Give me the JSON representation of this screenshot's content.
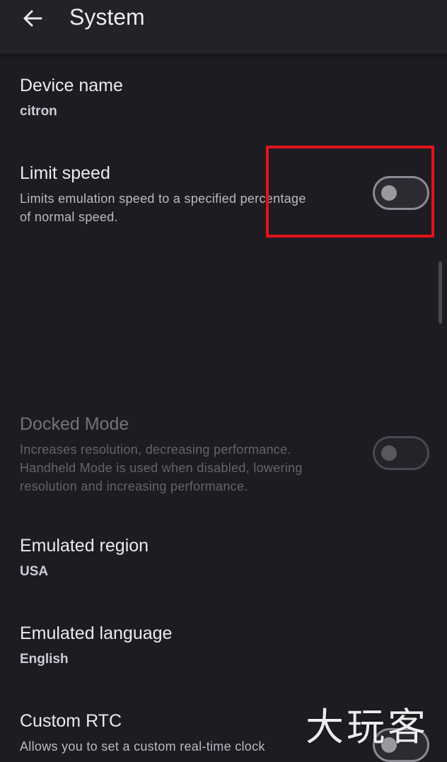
{
  "app_bar": {
    "title": "System",
    "back_icon": "arrow-back-icon"
  },
  "settings": [
    {
      "key": "device_name",
      "title": "Device name",
      "value": "citron"
    },
    {
      "key": "limit_speed",
      "title": "Limit speed",
      "description": "Limits emulation speed to a specified percentage\nof normal speed.",
      "toggle_on": false,
      "highlighted": true
    },
    {
      "key": "docked_mode",
      "title": "Docked Mode",
      "description": "Increases resolution, decreasing performance.\nHandheld Mode is used when disabled, lowering\nresolution and increasing performance.",
      "toggle_on": false,
      "enabled": false
    },
    {
      "key": "emulated_region",
      "title": "Emulated region",
      "value": "USA"
    },
    {
      "key": "emulated_language",
      "title": "Emulated language",
      "value": "English"
    },
    {
      "key": "custom_rtc",
      "title": "Custom RTC",
      "description": "Allows you to set a custom real-time clock",
      "toggle_on": false
    }
  ],
  "watermark": "大玩客",
  "colors": {
    "background": "#1d1c22",
    "app_bar": "#232228",
    "highlight": "#e4121a"
  }
}
